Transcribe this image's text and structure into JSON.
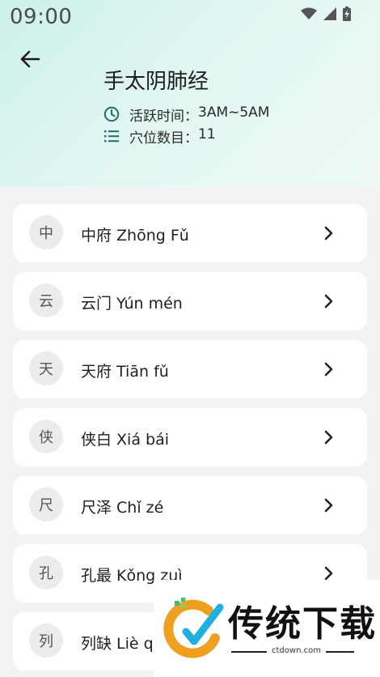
{
  "status": {
    "time": "09:00"
  },
  "header": {
    "title": "手太阴肺经",
    "active_time_label": "活跃时间：",
    "active_time_value": "3AM~5AM",
    "point_count_label": "穴位数目：",
    "point_count_value": "11"
  },
  "points": [
    {
      "char": "中",
      "label": "中府 Zhōng Fǔ"
    },
    {
      "char": "云",
      "label": "云门 Yún mén"
    },
    {
      "char": "天",
      "label": "天府 Tiān fǔ"
    },
    {
      "char": "侠",
      "label": "侠白 Xiá bái"
    },
    {
      "char": "尺",
      "label": "尺泽 Chǐ zé"
    },
    {
      "char": "孔",
      "label": "孔最 Kǒng zuì"
    },
    {
      "char": "列",
      "label": "列缺 Liè quē"
    }
  ],
  "watermark": {
    "brand": "传统下载",
    "url": "ctdown.com"
  },
  "colors": {
    "accent": "#1e6f68",
    "header_bg": "#d9f4ee"
  }
}
